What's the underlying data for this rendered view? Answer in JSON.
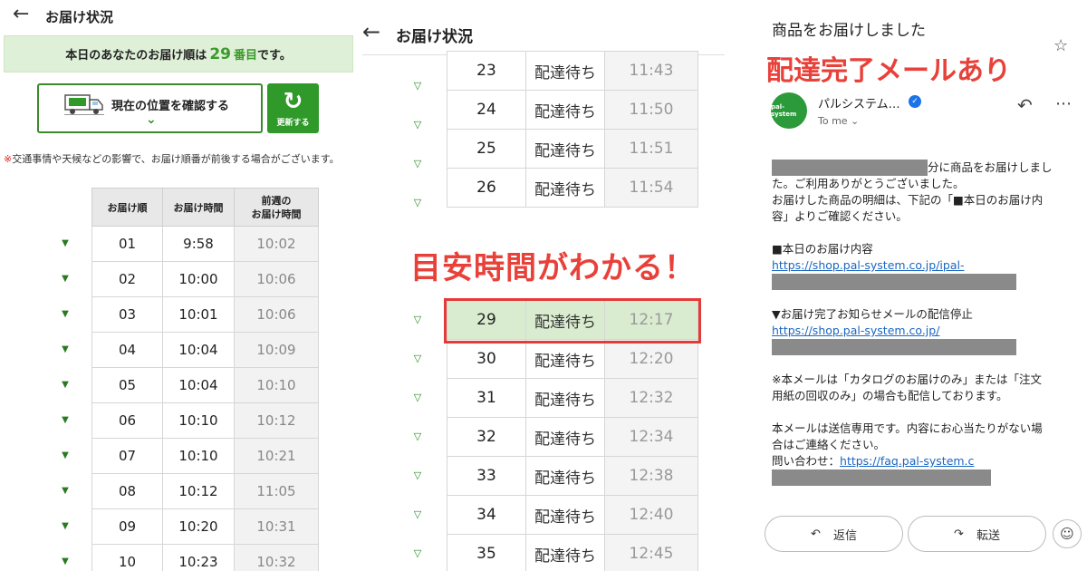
{
  "panel1": {
    "title": "お届け状況",
    "banner": {
      "prefix": "本日のあなたのお届け順は",
      "number": "29",
      "unit": "番目",
      "suffix": "です。"
    },
    "location_button": "現在の位置を確認する",
    "refresh_button": "更新する",
    "note_mark": "※",
    "note": "交通事情や天候などの影響で、お届け順番が前後する場合がございます。",
    "table": {
      "headers": [
        "お届け順",
        "お届け時間",
        "前週の\nお届け時間"
      ],
      "rows": [
        [
          "01",
          "9:58",
          "10:02"
        ],
        [
          "02",
          "10:00",
          "10:06"
        ],
        [
          "03",
          "10:01",
          "10:06"
        ],
        [
          "04",
          "10:04",
          "10:09"
        ],
        [
          "05",
          "10:04",
          "10:10"
        ],
        [
          "06",
          "10:10",
          "10:12"
        ],
        [
          "07",
          "10:10",
          "10:21"
        ],
        [
          "08",
          "10:12",
          "11:05"
        ],
        [
          "09",
          "10:20",
          "10:31"
        ],
        [
          "10",
          "10:23",
          "10:32"
        ]
      ]
    }
  },
  "panel2": {
    "title": "お届け状況",
    "caption": "目安時間がわかる！",
    "rows_top": [
      [
        "23",
        "配達待ち",
        "11:43"
      ],
      [
        "24",
        "配達待ち",
        "11:50"
      ],
      [
        "25",
        "配達待ち",
        "11:51"
      ],
      [
        "26",
        "配達待ち",
        "11:54"
      ]
    ],
    "rows_bottom": [
      [
        "29",
        "配達待ち",
        "12:17"
      ],
      [
        "30",
        "配達待ち",
        "12:20"
      ],
      [
        "31",
        "配達待ち",
        "12:32"
      ],
      [
        "32",
        "配達待ち",
        "12:34"
      ],
      [
        "33",
        "配達待ち",
        "12:38"
      ],
      [
        "34",
        "配達待ち",
        "12:40"
      ],
      [
        "35",
        "配達待ち",
        "12:45"
      ]
    ]
  },
  "panel3": {
    "subject": "商品をお届けしました",
    "caption": "配達完了メールあり",
    "avatar_text": "pal-system",
    "sender": "パルシステム…",
    "to": "To me ⌄",
    "body": {
      "line1_suffix": "分に商品をお届けしまし",
      "line2": "た。ご利用ありがとうございました。",
      "line3": "お届けした商品の明細は、下記の「■本日のお届け内",
      "line4": "容」よりご確認ください。",
      "sec1_title": "■本日のお届け内容",
      "sec1_link": "https://shop.pal-system.co.jp/ipal-",
      "sec2_title": "▼お届け完了お知らせメールの配信停止",
      "sec2_link": "https://shop.pal-system.co.jp/",
      "note1": "※本メールは「カタログのお届けのみ」または「注文",
      "note2": "用紙の回収のみ」の場合も配信しております。",
      "note3": "本メールは送信専用です。内容にお心当たりがない場",
      "note4": "合はご連絡ください。",
      "contact_label": "問い合わせ：",
      "contact_link": "https://faq.pal-system.c"
    },
    "reply_button": "返信",
    "forward_button": "転送"
  }
}
